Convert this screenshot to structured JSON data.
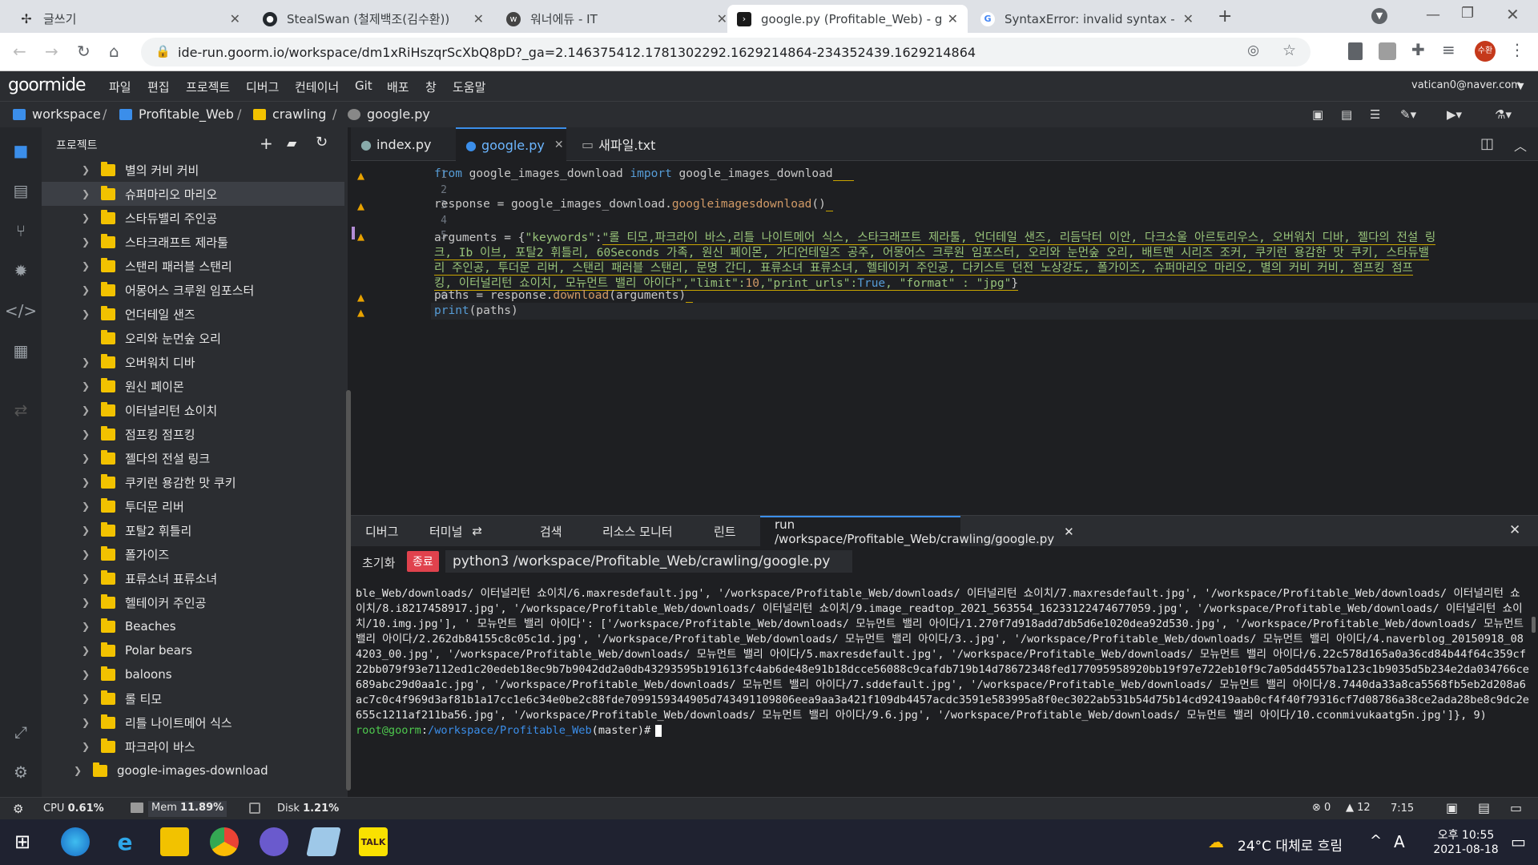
{
  "browser": {
    "tabs": [
      {
        "title": "글쓰기",
        "icon": "pinwheel-icon"
      },
      {
        "title": "StealSwan (철제백조(김수환))",
        "icon": "github-icon"
      },
      {
        "title": "워너에듀 - IT",
        "icon": "wannaedu-icon"
      },
      {
        "title": "google.py (Profitable_Web) - go",
        "icon": "goorm-icon"
      },
      {
        "title": "SyntaxError: invalid syntax - Goo",
        "icon": "google-icon"
      }
    ],
    "url": "ide-run.goorm.io/workspace/dm1xRiHszqrScXbQ8pD?_ga=2.146375412.1781302292.1629214864-234352439.1629214864",
    "profile_initials": "수환"
  },
  "ide": {
    "logo": "goormide",
    "menu": [
      "파일",
      "편집",
      "프로젝트",
      "디버그",
      "컨테이너",
      "Git",
      "배포",
      "창",
      "도움말"
    ],
    "user_email": "vatican0@naver.com",
    "breadcrumb": [
      "workspace",
      "Profitable_Web",
      "crawling",
      "google.py"
    ],
    "sidebar_title": "프로젝트",
    "tree": [
      {
        "label": "별의 커비 커비",
        "chevron": true
      },
      {
        "label": "슈퍼마리오 마리오",
        "chevron": true,
        "selected": true
      },
      {
        "label": "스타듀밸리 주인공",
        "chevron": true
      },
      {
        "label": "스타크래프트 제라툴",
        "chevron": true
      },
      {
        "label": "스탠리 패러블 스탠리",
        "chevron": true
      },
      {
        "label": "어몽어스 크루원 임포스터",
        "chevron": true
      },
      {
        "label": "언더테일 샌즈",
        "chevron": true
      },
      {
        "label": "오리와 눈먼숲 오리",
        "chevron": false
      },
      {
        "label": "오버워치 디바",
        "chevron": true
      },
      {
        "label": "원신 페이몬",
        "chevron": true
      },
      {
        "label": "이터널리턴 쇼이치",
        "chevron": true
      },
      {
        "label": "점프킹 점프킹",
        "chevron": true
      },
      {
        "label": "젤다의 전설 링크",
        "chevron": true
      },
      {
        "label": "쿠키런 용감한 맛 쿠키",
        "chevron": true
      },
      {
        "label": "투더문 리버",
        "chevron": true
      },
      {
        "label": "포탈2 휘틀리",
        "chevron": true
      },
      {
        "label": "폴가이즈",
        "chevron": true
      },
      {
        "label": "표류소녀 표류소녀",
        "chevron": true
      },
      {
        "label": "헬테이커 주인공",
        "chevron": true
      },
      {
        "label": "Beaches",
        "chevron": true
      },
      {
        "label": "Polar bears",
        "chevron": true
      },
      {
        "label": "baloons",
        "chevron": true
      },
      {
        "label": "롤 티모",
        "chevron": true
      },
      {
        "label": "리틀 나이트메어 식스",
        "chevron": true
      },
      {
        "label": "파크라이 바스",
        "chevron": true
      },
      {
        "label": "google-images-download",
        "chevron": true
      }
    ],
    "editor_tabs": [
      "index.py",
      "google.py",
      "새파일.txt"
    ],
    "code": {
      "l1": {
        "kw1": "from",
        "mod": " google_images_download ",
        "kw2": "import",
        "rest": " google_images_download"
      },
      "l3": {
        "a": "response = google_images_download.",
        "fn": "googleimagesdownload",
        "b": "()"
      },
      "l5a": "arguments = {",
      "l5key": "\"keywords\"",
      "l5colon": ":",
      "l5str1": "\"롤 티모,파크라이 바스,리틀 나이트메어 식스, 스타크래프트 제라툴, 언더테일 샌즈, 리듬닥터 이안, 다크소울 아르토리우스, 오버워치 디바, 젤다의 전설 링",
      "l5str2": "크, Ib 이브, 포탈2 휘틀리, 60Seconds 가족, 원신 페이몬, 가디언테일즈 공주, 어몽어스 크루원 임포스터, 오리와 눈먼숲 오리, 배트맨 시리즈 조커, 쿠키런 용감한 맛 쿠키, 스타듀밸",
      "l5str3": "리 주인공, 투더문 리버, 스탠리 패러블 스탠리, 문명 간디, 표류소녀 표류소녀, 헬테이커 주인공, 다키스트 던전 노상강도, 폴가이즈, 슈퍼마리오 마리오, 별의 커비 커비, 점프킹 점프",
      "l5str4": "킹, 이터널리턴 쇼이치, 모뉴먼트 밸리 아이다\"",
      "l5limit": ",\"limit\":",
      "l5num": "10",
      "l5pu": ",\"print_urls\":",
      "l5true": "True",
      "l5fmt": ", \"format\" : ",
      "l5jpg": "\"jpg\"",
      "l5end": "}",
      "l6a": "paths = response.",
      "l6fn": "download",
      "l6b": "(arguments)",
      "l7fn": "print",
      "l7b": "(paths)"
    },
    "line_numbers": [
      "1",
      "2",
      "3",
      "4",
      "5",
      "6",
      "7"
    ],
    "panel_tabs": [
      "디버그",
      "터미널",
      "검색",
      "리소스 모니터",
      "린트",
      "run /workspace/Profitable_Web/crawling/google.py"
    ],
    "run": {
      "reset_label": "초기화",
      "stop_label": "종료",
      "command": "python3 /workspace/Profitable_Web/crawling/google.py"
    },
    "terminal_output": "ble_Web/downloads/ 이터널리턴 쇼이치/6.maxresdefault.jpg', '/workspace/Profitable_Web/downloads/ 이터널리턴 쇼이치/7.maxresdefault.jpg', '/workspace/Profitable_Web/downloads/ 이터널리턴 쇼이치/8.i8217458917.jpg', '/workspace/Profitable_Web/downloads/ 이터널리턴 쇼이치/9.image_readtop_2021_563554_16233122474677059.jpg', '/workspace/Profitable_Web/downloads/ 이터널리턴 쇼이치/10.img.jpg'], ' 모뉴먼트 밸리 아이다': ['/workspace/Profitable_Web/downloads/ 모뉴먼트 밸리 아이다/1.270f7d918add7db5d6e1020dea92d530.jpg', '/workspace/Profitable_Web/downloads/ 모뉴먼트 밸리 아이다/2.262db84155c8c05c1d.jpg', '/workspace/Profitable_Web/downloads/ 모뉴먼트 밸리 아이다/3..jpg', '/workspace/Profitable_Web/downloads/ 모뉴먼트 밸리 아이다/4.naverblog_20150918_084203_00.jpg', '/workspace/Profitable_Web/downloads/ 모뉴먼트 밸리 아이다/5.maxresdefault.jpg', '/workspace/Profitable_Web/downloads/ 모뉴먼트 밸리 아이다/6.22c578d165a0a36cd84b44f64c359cf22bb079f93e7112ed1c20edeb18ec9b7b9042dd2a0db43293595b191613fc4ab6de48e91b18dcce56088c9cafdb719b14d78672348fed177095958920bb19f97e722eb10f9c7a05dd4557ba123c1b9035d5b234e2da034766ce689abc29d0aa1c.jpg', '/workspace/Profitable_Web/downloads/ 모뉴먼트 밸리 아이다/7.sddefault.jpg', '/workspace/Profitable_Web/downloads/ 모뉴먼트 밸리 아이다/8.7440da33a8ca5568fb5eb2d208a6ac7c0c4f969d3af81b1a17cc1e6c34e0be2c88fde7099159344905d743491109806eea9aa3a421f109db4457acdc3591e583995a8f0ec3022ab531b54d75b14cd92419aab0cf4f40f79316cf7d08786a38ce2ada28be8c9dc2e655c1211af211ba56.jpg', '/workspace/Profitable_Web/downloads/ 모뉴먼트 밸리 아이다/9.6.jpg', '/workspace/Profitable_Web/downloads/ 모뉴먼트 밸리 아이다/10.cconmivukaatg5n.jpg']}, 9)",
    "prompt_user": "root@goorm",
    "prompt_sep": ":",
    "prompt_path": "/workspace/Profitable_Web",
    "prompt_branch": "(master)#",
    "status": {
      "cpu_label": "CPU",
      "cpu": "0.61%",
      "mem_label": "Mem",
      "mem": "11.89%",
      "disk_label": "Disk",
      "disk": "1.21%",
      "errors": "0",
      "warnings": "12",
      "cursor": "7:15"
    }
  },
  "taskbar": {
    "weather": "24°C 대체로 흐림",
    "ime": "A",
    "time": "오후 10:55",
    "date": "2021-08-18",
    "app_icons": [
      "windows-start-icon",
      "edge-icon",
      "ie-icon",
      "file-explorer-icon",
      "chrome-icon",
      "app-icon",
      "notes-icon",
      "kakaotalk-icon"
    ],
    "kakaotalk_label": "TALK"
  }
}
